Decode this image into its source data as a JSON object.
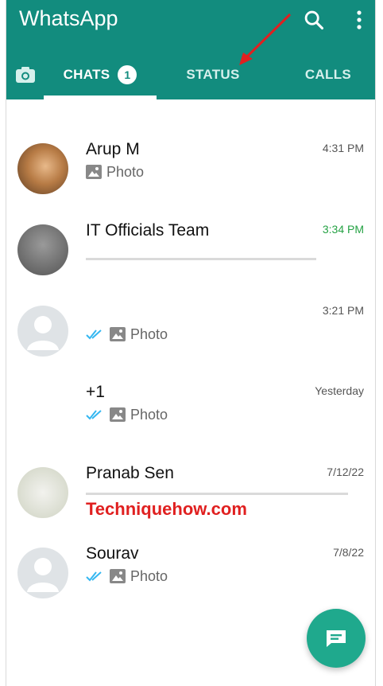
{
  "app": {
    "title": "WhatsApp"
  },
  "tabs": [
    {
      "label": "CHATS",
      "badge": "1",
      "active": true
    },
    {
      "label": "STATUS",
      "active": false
    },
    {
      "label": "CALLS",
      "active": false
    }
  ],
  "chats": [
    {
      "name": "Arup M",
      "time": "4:31 PM",
      "preview": "Photo",
      "ticks": false,
      "unread": false
    },
    {
      "name": "IT Officials Team",
      "time": "3:34 PM",
      "preview": "",
      "ticks": false,
      "unread": true
    },
    {
      "name": "",
      "time": "3:21 PM",
      "preview": "Photo",
      "ticks": true,
      "unread": false
    },
    {
      "name": "+1",
      "time": "Yesterday",
      "preview": "Photo",
      "ticks": true,
      "unread": false
    },
    {
      "name": "Pranab Sen",
      "time": "7/12/22",
      "preview": "",
      "ticks": false,
      "unread": false
    },
    {
      "name": "Sourav",
      "time": "7/8/22",
      "preview": "Photo",
      "ticks": true,
      "unread": false
    }
  ],
  "watermark": "Techniquehow.com",
  "colors": {
    "header": "#128C7E",
    "accent": "#25a244",
    "fab": "#1fa98d",
    "arrow": "#e02020"
  },
  "icons": [
    "camera-icon",
    "search-icon",
    "more-vert-icon",
    "image-icon",
    "double-check-icon",
    "new-chat-icon"
  ]
}
